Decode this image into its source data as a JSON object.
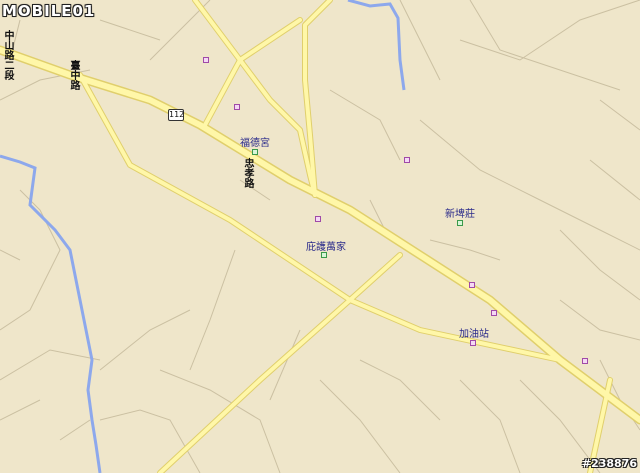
{
  "logo": "MOBILE01",
  "watermark": "#238876",
  "route_shield": "112",
  "roads": {
    "zhongshan_road_sec2": "中山路二段",
    "taizhong_road": "臺中路",
    "zhongxiao_road": "忠孝路"
  },
  "places": {
    "fude_temple": "福德宮",
    "dihu_household": "庇護萬家",
    "xinbei_village": "新埤莊",
    "gas_station": "加油站"
  },
  "colors": {
    "land": "#efe6ca",
    "road_fill": "#fff7a8",
    "road_casing": "#e0cf6c",
    "river": "#8da8ec",
    "minor_line": "#cfc4a8"
  }
}
